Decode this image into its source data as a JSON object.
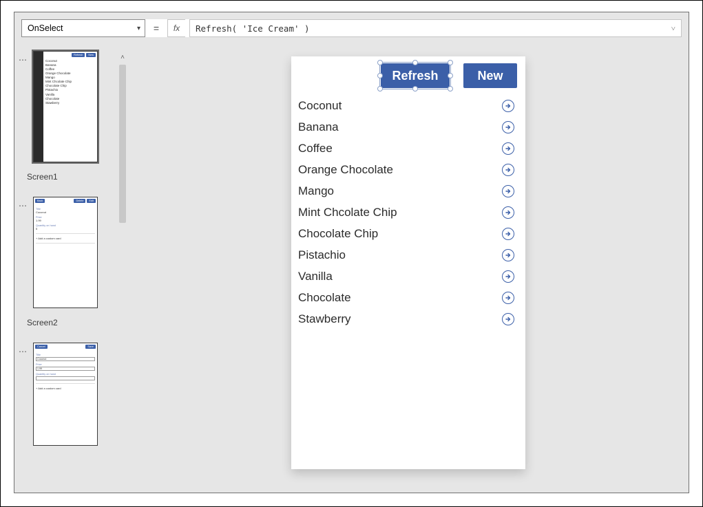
{
  "formula_bar": {
    "property": "OnSelect",
    "equals": "=",
    "fx": "fx",
    "expression": "Refresh( 'Ice Cream' )"
  },
  "thumbnails": [
    {
      "label": "Screen1",
      "buttons": [
        "Refresh",
        "New"
      ],
      "items": [
        "Coconut",
        "Banana",
        "Coffee",
        "Orange Chocolate",
        "Mango",
        "Mint Chcolate Chip",
        "Chocolate Chip",
        "Pistachio",
        "Vanilla",
        "Chocolate",
        "Stawberry"
      ]
    },
    {
      "label": "Screen2",
      "buttons": [
        "Back",
        "Delete",
        "Edit"
      ],
      "fields": [
        {
          "label": "Title",
          "value": "Coconut"
        },
        {
          "label": "Price",
          "value": "1.99"
        },
        {
          "label": "Quantity on hand",
          "value": "5"
        }
      ],
      "add_card": "+  Add a custom card"
    },
    {
      "label": "",
      "buttons": [
        "Cancel",
        "Save"
      ],
      "fields": [
        {
          "label": "Title",
          "value": "Coconut"
        },
        {
          "label": "Price",
          "value": "1.99"
        },
        {
          "label": "Quantity on hand",
          "value": ""
        }
      ],
      "add_card": "+  Add a custom card"
    }
  ],
  "canvas": {
    "refresh_label": "Refresh",
    "new_label": "New",
    "items": [
      "Coconut",
      "Banana",
      "Coffee",
      "Orange Chocolate",
      "Mango",
      "Mint Chcolate Chip",
      "Chocolate Chip",
      "Pistachio",
      "Vanilla",
      "Chocolate",
      "Stawberry"
    ]
  },
  "colors": {
    "brand": "#3b5fa8"
  }
}
